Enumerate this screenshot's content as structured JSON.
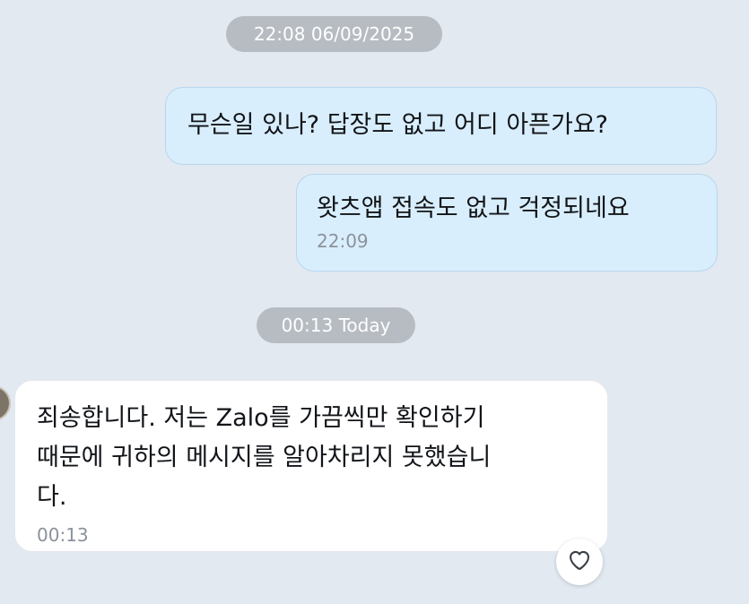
{
  "separators": [
    {
      "label": "22:08 06/09/2025"
    },
    {
      "label": "00:13 Today"
    }
  ],
  "messages": {
    "sent_1": {
      "text": "무슨일 있나? 답장도 없고 어디 아픈가요?"
    },
    "sent_2": {
      "text": "왓츠앱 접속도 없고 걱정되네요",
      "time": "22:09"
    },
    "received_1": {
      "lines": [
        "죄송합니다. 저는 Zalo를 가끔씩만 확인하기",
        "때문에 귀하의 메시지를 알아차리지 못했습니",
        "다."
      ],
      "time": "00:13"
    }
  },
  "reaction": {
    "icon": "heart-outline-icon"
  },
  "colors": {
    "background": "#e2e9f1",
    "sent_bubble": "#d9eefc",
    "received_bubble": "#ffffff",
    "time_pill": "#b7bcc3"
  }
}
